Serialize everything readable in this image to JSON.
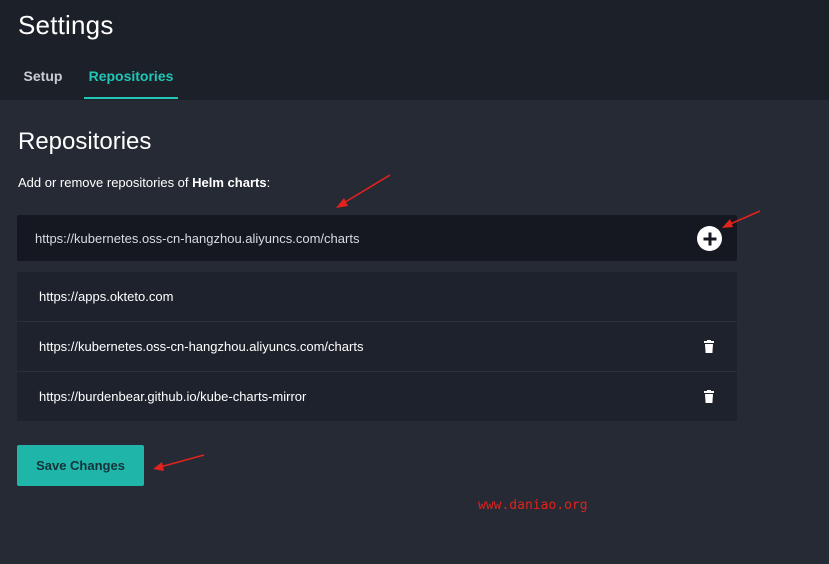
{
  "app": {
    "title": "Settings"
  },
  "tabs": [
    {
      "label": "Setup",
      "active": false
    },
    {
      "label": "Repositories",
      "active": true
    }
  ],
  "section": {
    "title": "Repositories",
    "description_prefix": "Add or remove repositories of ",
    "description_bold": "Helm charts",
    "description_suffix": ":"
  },
  "add_repo": {
    "value": "https://kubernetes.oss-cn-hangzhou.aliyuncs.com/charts",
    "add_icon": "plus-circle-icon"
  },
  "repositories": [
    {
      "url": "https://apps.okteto.com",
      "deletable": false
    },
    {
      "url": "https://kubernetes.oss-cn-hangzhou.aliyuncs.com/charts",
      "deletable": true
    },
    {
      "url": "https://burdenbear.github.io/kube-charts-mirror",
      "deletable": true
    }
  ],
  "save_button": {
    "label": "Save Changes"
  },
  "watermark": "www.daniao.org",
  "colors": {
    "accent": "#20c6b6",
    "button": "#1fb6a9",
    "background": "#252a35",
    "header_background": "#1c2029",
    "annotation": "#e0231c"
  }
}
